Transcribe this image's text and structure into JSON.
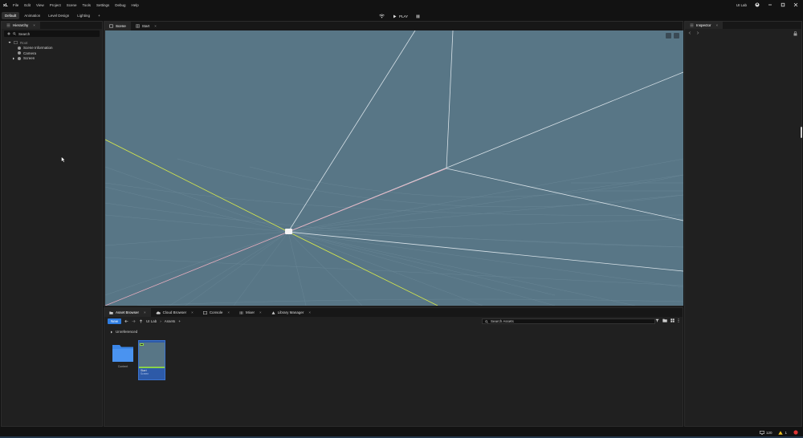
{
  "app": {
    "logo": "xL"
  },
  "menu": [
    "File",
    "Edit",
    "View",
    "Project",
    "Scene",
    "Tools",
    "Settings",
    "Debug",
    "Help"
  ],
  "window": {
    "user": "UI Lab"
  },
  "layouts": {
    "tabs": [
      "Default",
      "Animation",
      "Level Design",
      "Lighting"
    ],
    "add": "+"
  },
  "play": {
    "label": "PLAY"
  },
  "hierarchy": {
    "tab": "Hierarchy",
    "search_placeholder": "Search",
    "root": "Root",
    "items": [
      "Scene Information",
      "Camera",
      "Screen"
    ]
  },
  "viewport": {
    "tabs": [
      "Scene",
      "Start"
    ]
  },
  "bottom": {
    "tabs": [
      "Asset Browser",
      "Cloud Browser",
      "Console",
      "Mixer",
      "Library Manager"
    ],
    "new": "New",
    "crumbs": [
      "UI Lab",
      "Assets"
    ],
    "search_placeholder": "Search Assets",
    "group": "Unreferenced",
    "assets": [
      {
        "name": "Content"
      },
      {
        "name": "Start",
        "type": "Screen"
      }
    ]
  },
  "inspector": {
    "tab": "Inspector"
  },
  "status": {
    "fps": "120",
    "warnings": "1"
  },
  "colors": {
    "accent": "#2f7de1",
    "viewport_bg": "#587686",
    "panel": "#202020"
  }
}
